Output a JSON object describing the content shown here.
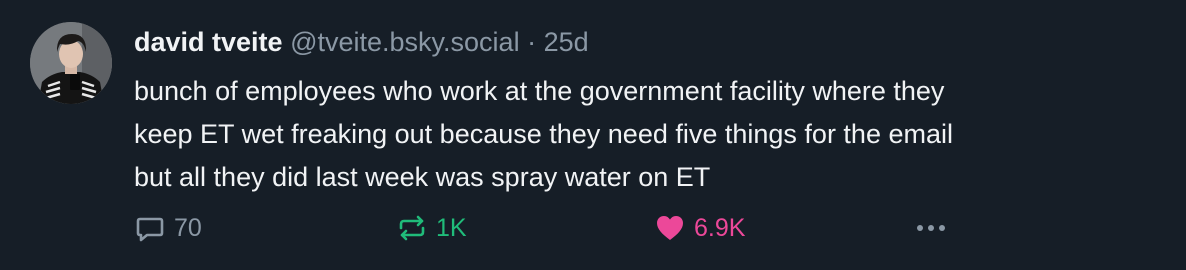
{
  "post": {
    "author": {
      "display_name": "david tveite",
      "handle": "@tveite.bsky.social",
      "separator": "·",
      "timestamp": "25d"
    },
    "text_lines": [
      "bunch of employees who work at the government facility where they",
      "keep ET wet freaking out because they need five things for the email",
      "but all they did last week was spray water on ET"
    ],
    "actions": {
      "reply_count": "70",
      "repost_count": "1K",
      "like_count": "6.9K"
    }
  },
  "colors": {
    "background": "#161e27",
    "text": "#f1f3f5",
    "muted": "#8b98a5",
    "repost_active": "#20bc7a",
    "like_active": "#ec4899"
  },
  "icons": {
    "reply": "speech-bubble-icon",
    "repost": "repost-arrows-icon",
    "like": "heart-icon",
    "more": "ellipsis-icon"
  }
}
